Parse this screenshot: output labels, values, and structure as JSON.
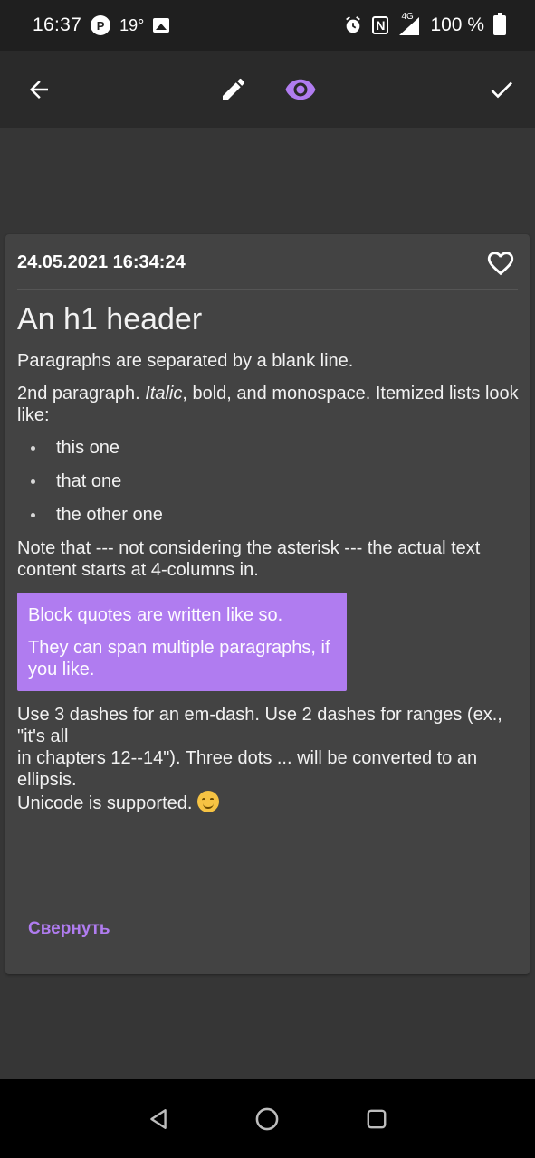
{
  "status_bar": {
    "time": "16:37",
    "temperature": "19°",
    "signal_label": "4G",
    "battery": "100 %"
  },
  "toolbar": {
    "back_icon": "arrow-left-icon",
    "edit_icon": "pencil-icon",
    "preview_icon": "eye-icon",
    "done_icon": "check-icon",
    "accent_color": "#b07cf0"
  },
  "note": {
    "date": "24.05.2021 16:34:24",
    "favorite_icon": "heart-outline-icon",
    "h1": "An h1 header",
    "paragraph1": "Paragraphs are separated by a blank line.",
    "paragraph2_start": "2nd paragraph. ",
    "paragraph2_italic": "Italic",
    "paragraph2_end": ", bold, and monospace. Itemized lists look like:",
    "list": [
      "this one",
      "that one",
      "the other one"
    ],
    "paragraph3": "Note that --- not considering the asterisk --- the actual text content starts at 4-columns in.",
    "quote": [
      "Block quotes are written like so.",
      "They can span multiple paragraphs, if you like."
    ],
    "paragraph4_line1": "Use 3 dashes for an em-dash. Use 2 dashes for ranges (ex., \"it's all",
    "paragraph4_line2": "in chapters 12--14\"). Three dots ... will be converted to an ellipsis.",
    "paragraph4_line3": "Unicode is supported.",
    "collapse_label": "Свернуть"
  },
  "nav_bar": {
    "back": "triangle-back-icon",
    "home": "circle-home-icon",
    "recents": "square-recents-icon"
  }
}
